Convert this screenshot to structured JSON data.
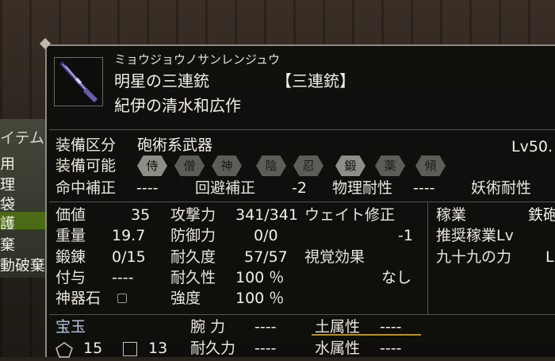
{
  "left_menu": {
    "title": "イテム",
    "items": [
      "用",
      "理",
      "袋",
      "護",
      "棄",
      "動破棄"
    ],
    "highlighted_index": 3
  },
  "item": {
    "reading": "ミョウジョウノサンレンジュウ",
    "name": "明星の三連銃",
    "category_bracket": "【三連銃】",
    "maker": "紀伊の清水和広作",
    "icon": "rifle-icon"
  },
  "equip": {
    "class_label": "装備区分",
    "class_value": "砲術系武器",
    "level": "Lv50.",
    "usable_label": "装備可能",
    "classes": [
      {
        "text": "侍",
        "on": true
      },
      {
        "text": "僧",
        "on": false
      },
      {
        "text": "神",
        "on": false
      },
      {
        "text": "陰",
        "on": false
      },
      {
        "text": "忍",
        "on": false
      },
      {
        "text": "鍛",
        "on": true
      },
      {
        "text": "薬",
        "on": false
      },
      {
        "text": "傾",
        "on": false
      }
    ]
  },
  "corrections": {
    "hit_label": "命中補正",
    "hit_value": "----",
    "evade_label": "回避補正",
    "evade_value": "-2",
    "phys_label": "物理耐性",
    "phys_value": "----",
    "magic_label": "妖術耐性"
  },
  "stats": {
    "price_label": "価値",
    "price_value": "35",
    "weight_label": "重量",
    "weight_value": "19.7",
    "forge_label": "鍛錬",
    "forge_value": "0/15",
    "grant_label": "付与",
    "grant_value": "----",
    "sacred_label": "神器石",
    "attack_label": "攻撃力",
    "attack_value": "341/341",
    "defense_label": "防御力",
    "defense_value": "0/0",
    "durability_label": "耐久度",
    "durability_value": "57/57",
    "resist_label": "耐久性",
    "resist_value": "100 ％",
    "strength_label": "強度",
    "strength_value": "100 ％",
    "wait_label": "ウェイト修正",
    "wait_value": "-1",
    "visual_label": "視覚効果",
    "visual_value": "なし"
  },
  "right_col": {
    "job_label": "稼業",
    "job_value": "鉄砲",
    "rec_label": "推奨稼業Lv",
    "ninety_label": "九十九の力",
    "ninety_value": "L"
  },
  "gems": {
    "label": "宝玉",
    "pentagon_count": "15",
    "square_count": "13",
    "arm_label": "腕 力",
    "arm_value": "----",
    "endure_label": "耐久力",
    "endure_value": "----",
    "earth_label": "土属性",
    "earth_value": "----",
    "water_label": "水属性",
    "water_value": "----"
  },
  "colors": {
    "highlight": "#4a6a16",
    "gold_line": "#b88f2a",
    "panel_bg": "#0e0e0c"
  }
}
